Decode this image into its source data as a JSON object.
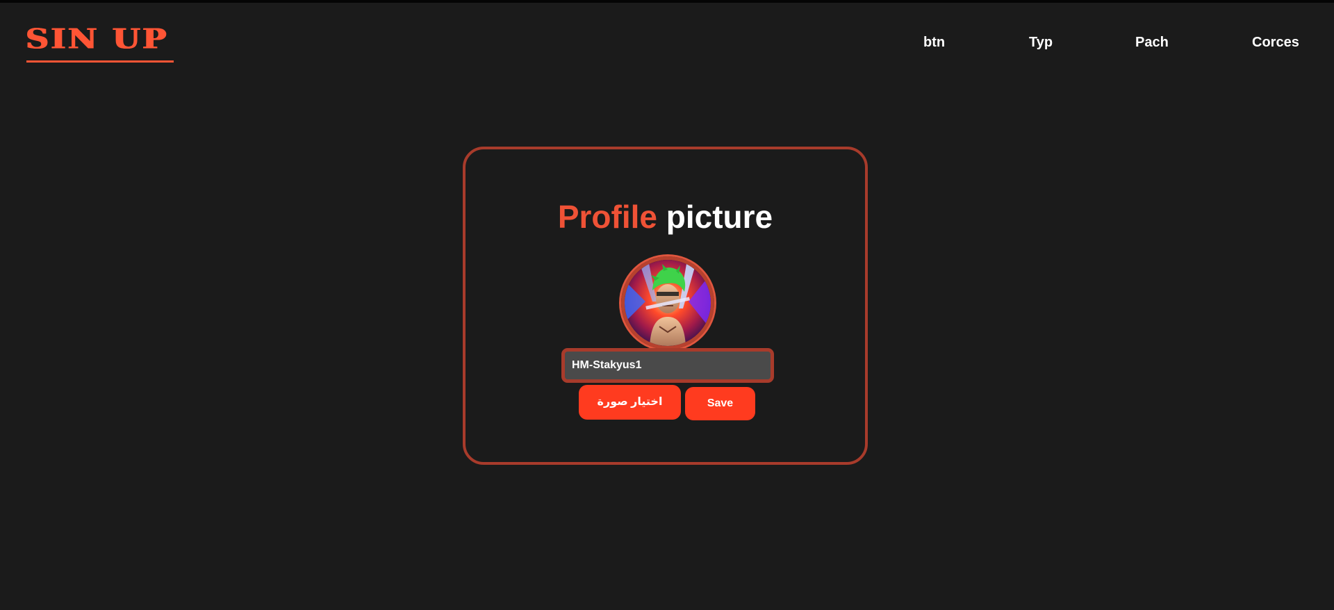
{
  "header": {
    "logo_text": "SIN UP",
    "nav": [
      {
        "label": "btn"
      },
      {
        "label": "Typ"
      },
      {
        "label": "Pach"
      },
      {
        "label": "Corces"
      }
    ]
  },
  "card": {
    "title_accent": "Profile",
    "title_rest": "picture",
    "avatar_icon": "profile-avatar-image",
    "username_value": "HM-Stakyus1",
    "choose_image_label": "اختيار صورة",
    "save_label": "Save"
  },
  "colors": {
    "background": "#1b1b1b",
    "accent": "#ff5535",
    "button": "#ff3b1f",
    "card_border": "#a83b2b"
  }
}
